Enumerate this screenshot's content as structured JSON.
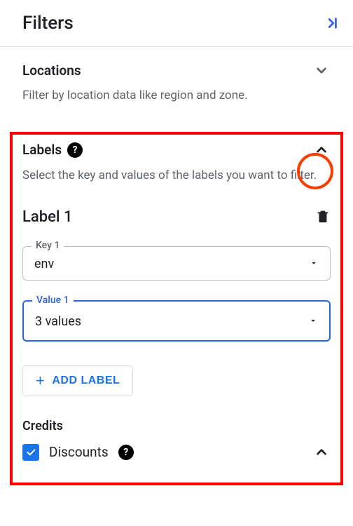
{
  "header": {
    "title": "Filters"
  },
  "locations": {
    "title": "Locations",
    "description": "Filter by location data like region and zone."
  },
  "labels": {
    "title": "Labels",
    "description": "Select the key and values of the labels you want to filter.",
    "block_title": "Label 1",
    "key_field": {
      "label": "Key 1",
      "value": "env"
    },
    "value_field": {
      "label": "Value 1",
      "value": "3 values"
    },
    "add_button": "ADD LABEL"
  },
  "credits": {
    "title": "Credits",
    "option1": "Discounts"
  }
}
